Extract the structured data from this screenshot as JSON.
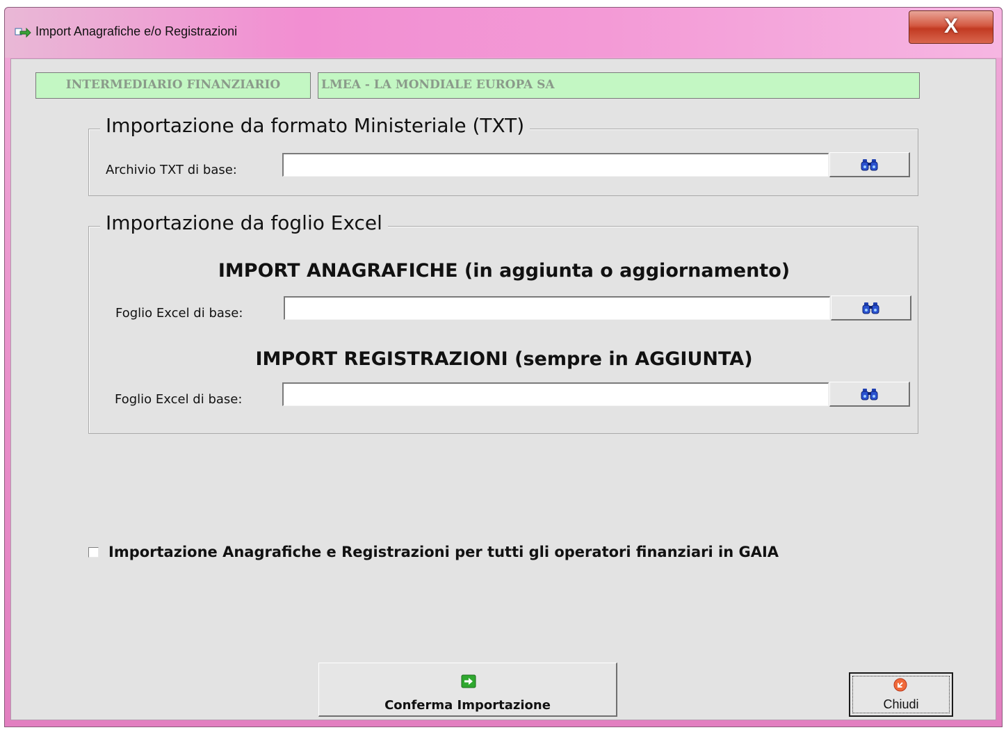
{
  "window": {
    "title": "Import Anagrafiche e/o Registrazioni",
    "close_label": "X"
  },
  "header": {
    "intermediary_label": "INTERMEDIARIO FINANZIARIO",
    "intermediary_value": "LMEA - LA MONDIALE EUROPA SA"
  },
  "txt_section": {
    "legend": "Importazione da formato Ministeriale (TXT)",
    "file_label": "Archivio TXT di base:",
    "file_value": ""
  },
  "excel_section": {
    "legend": "Importazione da foglio Excel",
    "anagrafiche_heading": "IMPORT ANAGRAFICHE (in aggiunta o aggiornamento)",
    "anagrafiche_label": "Foglio Excel di base:",
    "anagrafiche_value": "",
    "registrazioni_heading": "IMPORT REGISTRAZIONI (sempre in AGGIUNTA)",
    "registrazioni_label": "Foglio Excel di base:",
    "registrazioni_value": ""
  },
  "options": {
    "all_operators_label": "Importazione Anagrafiche e Registrazioni per tutti gli operatori finanziari in GAIA",
    "all_operators_checked": false
  },
  "footer": {
    "confirm_label": "Conferma Importazione",
    "close_label": "Chiudi"
  },
  "icons": {
    "title": "arrow-right-icon",
    "browse": "binoculars-icon",
    "confirm": "green-arrow-icon",
    "close": "red-exit-icon"
  },
  "colors": {
    "title_bar": "#f39ad6",
    "close_button": "#c23a22",
    "info_box": "#c3f7c3",
    "dialog_bg": "#e3e3e3"
  }
}
